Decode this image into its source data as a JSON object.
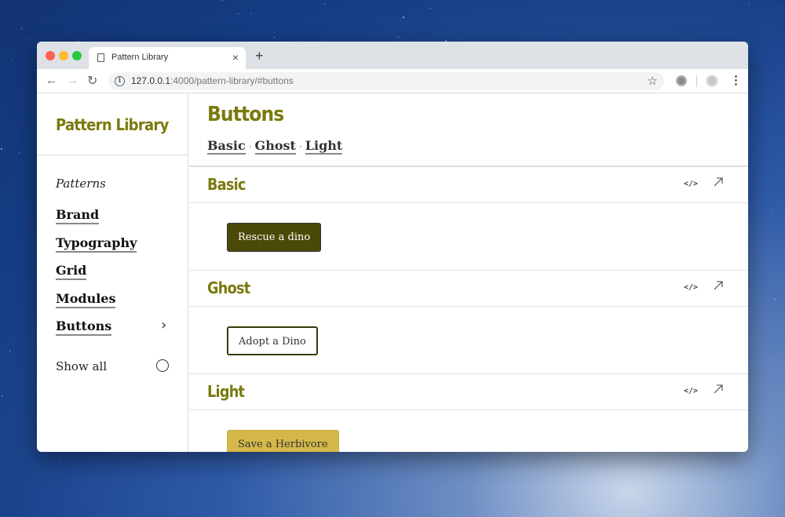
{
  "browser": {
    "tab_title": "Pattern Library",
    "url_host": "127.0.0.1",
    "url_rest": ":4000/pattern-library/#buttons",
    "new_tab": "+",
    "close": "×"
  },
  "sidebar": {
    "title": "Pattern Library",
    "section_label": "Patterns",
    "items": [
      {
        "label": "Brand"
      },
      {
        "label": "Typography"
      },
      {
        "label": "Grid"
      },
      {
        "label": "Modules"
      },
      {
        "label": "Buttons",
        "active": true
      }
    ],
    "show_all": "Show all"
  },
  "main": {
    "title": "Buttons",
    "anchors": [
      "Basic",
      "Ghost",
      "Light"
    ],
    "separator": "·",
    "sections": [
      {
        "title": "Basic",
        "button": "Rescue a dino"
      },
      {
        "title": "Ghost",
        "button": "Adopt a Dino"
      },
      {
        "title": "Light",
        "button": "Save a Herbivore"
      }
    ],
    "code_icon": "</>"
  },
  "colors": {
    "accent": "#7a7a0e",
    "basic_button": "#4a4a08",
    "light_button": "#d4b94a"
  }
}
